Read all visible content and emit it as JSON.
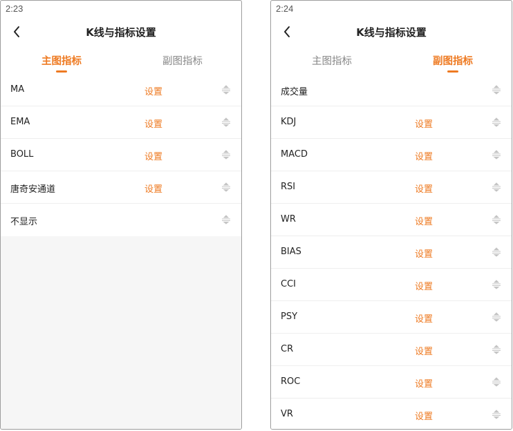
{
  "colors": {
    "accent": "#ee7a22",
    "text": "#222222",
    "inactive_tab": "#888888",
    "drag_icon": "#bbbbbb"
  },
  "screens": [
    {
      "time": "2:23",
      "title": "K线与指标设置",
      "back_icon": "chevron-left-icon",
      "tabs": [
        {
          "label": "主图指标",
          "active": true
        },
        {
          "label": "副图指标",
          "active": false
        }
      ],
      "indicators": [
        {
          "name": "MA",
          "setting": "设置"
        },
        {
          "name": "EMA",
          "setting": "设置"
        },
        {
          "name": "BOLL",
          "setting": "设置"
        },
        {
          "name": "唐奇安通道",
          "setting": "设置"
        },
        {
          "name": "不显示",
          "setting": ""
        }
      ],
      "drag_icon": "drag-handle-icon"
    },
    {
      "time": "2:24",
      "title": "K线与指标设置",
      "back_icon": "chevron-left-icon",
      "tabs": [
        {
          "label": "主图指标",
          "active": false
        },
        {
          "label": "副图指标",
          "active": true
        }
      ],
      "indicators": [
        {
          "name": "成交量",
          "setting": ""
        },
        {
          "name": "KDJ",
          "setting": "设置"
        },
        {
          "name": "MACD",
          "setting": "设置"
        },
        {
          "name": "RSI",
          "setting": "设置"
        },
        {
          "name": "WR",
          "setting": "设置"
        },
        {
          "name": "BIAS",
          "setting": "设置"
        },
        {
          "name": "CCI",
          "setting": "设置"
        },
        {
          "name": "PSY",
          "setting": "设置"
        },
        {
          "name": "CR",
          "setting": "设置"
        },
        {
          "name": "ROC",
          "setting": "设置"
        },
        {
          "name": "VR",
          "setting": "设置"
        }
      ],
      "drag_icon": "drag-handle-icon"
    }
  ]
}
